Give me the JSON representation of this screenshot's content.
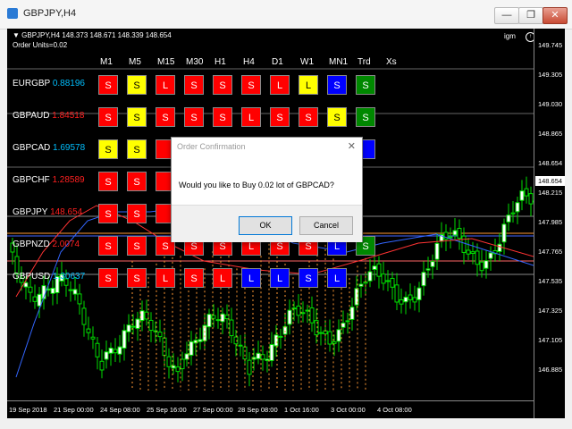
{
  "window": {
    "title": "GBPJPY,H4",
    "min": "—",
    "max": "❐",
    "close": "✕"
  },
  "chart": {
    "symbol_line": "▼ GBPJPY,H4  148.373 148.671 148.339 148.654",
    "order_units": "Order Units=0.02",
    "logo": "igm",
    "current_price": "148.654",
    "y_ticks": [
      "149.745",
      "149.305",
      "149.030",
      "148.865",
      "148.654",
      "148.215",
      "147.985",
      "147.765",
      "147.535",
      "147.325",
      "147.105",
      "146.885"
    ],
    "x_ticks": [
      "19 Sep 2018",
      "21 Sep 00:00",
      "24 Sep 08:00",
      "25 Sep 16:00",
      "27 Sep 00:00",
      "28 Sep 08:00",
      "1 Oct 16:00",
      "3 Oct 00:00",
      "4 Oct 08:00"
    ]
  },
  "columns": [
    "M1",
    "M5",
    "M15",
    "M30",
    "H1",
    "H4",
    "D1",
    "W1",
    "MN1",
    "Trd",
    "Xs"
  ],
  "rows": [
    {
      "pair": "EURGBP",
      "value": "0.88196",
      "value_color": "blue",
      "cells": [
        [
          "S",
          "red"
        ],
        [
          "S",
          "yellow"
        ],
        [
          "L",
          "red"
        ],
        [
          "S",
          "red"
        ],
        [
          "S",
          "red"
        ],
        [
          "S",
          "red"
        ],
        [
          "L",
          "red"
        ],
        [
          "L",
          "yellow"
        ],
        [
          "S",
          "blue"
        ],
        [
          "S",
          "green"
        ]
      ]
    },
    {
      "pair": "GBPAUD",
      "value": "1.84518",
      "value_color": "red",
      "cells": [
        [
          "S",
          "red"
        ],
        [
          "S",
          "yellow"
        ],
        [
          "S",
          "red"
        ],
        [
          "S",
          "red"
        ],
        [
          "S",
          "red"
        ],
        [
          "L",
          "red"
        ],
        [
          "S",
          "red"
        ],
        [
          "S",
          "red"
        ],
        [
          "S",
          "yellow"
        ],
        [
          "S",
          "green"
        ]
      ]
    },
    {
      "pair": "GBPCAD",
      "value": "1.69578",
      "value_color": "blue",
      "cells": [
        [
          "S",
          "yellow"
        ],
        [
          "S",
          "yellow"
        ],
        [
          "",
          "red"
        ],
        [
          "",
          "red"
        ],
        [
          "",
          "red"
        ],
        [
          "",
          "red"
        ],
        [
          "",
          "red"
        ],
        [
          "",
          "red"
        ],
        [
          "",
          "green"
        ],
        [
          "",
          "blank"
        ]
      ]
    },
    {
      "pair": "GBPCHF",
      "value": "1.28589",
      "value_color": "red",
      "cells": [
        [
          "S",
          "red"
        ],
        [
          "S",
          "red"
        ],
        [
          "",
          "red"
        ],
        [
          "",
          "red"
        ],
        [
          "",
          "red"
        ],
        [
          "",
          "red"
        ],
        [
          "",
          "red"
        ],
        [
          "",
          "red"
        ],
        [
          "",
          "green"
        ],
        [
          "",
          "none"
        ]
      ]
    },
    {
      "pair": "GBPJPY",
      "value": "148.654",
      "value_color": "red",
      "cells": [
        [
          "S",
          "red"
        ],
        [
          "S",
          "red"
        ],
        [
          "",
          "red"
        ],
        [
          "",
          "red"
        ],
        [
          "",
          "red"
        ],
        [
          "",
          "red"
        ],
        [
          "",
          "red"
        ],
        [
          "",
          "red"
        ],
        [
          "",
          "green"
        ],
        [
          "",
          "none"
        ]
      ]
    },
    {
      "pair": "GBPNZD",
      "value": "2.0074",
      "value_color": "red",
      "cells": [
        [
          "S",
          "red"
        ],
        [
          "S",
          "red"
        ],
        [
          "S",
          "red"
        ],
        [
          "S",
          "red"
        ],
        [
          "S",
          "red"
        ],
        [
          "L",
          "red"
        ],
        [
          "S",
          "red"
        ],
        [
          "S",
          "red"
        ],
        [
          "L",
          "blue"
        ],
        [
          "S",
          "green"
        ]
      ]
    },
    {
      "pair": "GBPUSD",
      "value": "1.30637",
      "value_color": "blue",
      "cells": [
        [
          "S",
          "red"
        ],
        [
          "S",
          "red"
        ],
        [
          "L",
          "red"
        ],
        [
          "S",
          "red"
        ],
        [
          "L",
          "red"
        ],
        [
          "L",
          "blue"
        ],
        [
          "L",
          "blue"
        ],
        [
          "S",
          "blue"
        ],
        [
          "L",
          "blue"
        ],
        [
          "",
          "none"
        ]
      ]
    }
  ],
  "dialog": {
    "title": "Order Confirmation",
    "message": "Would you like to Buy 0.02 lot of GBPCAD?",
    "ok": "OK",
    "cancel": "Cancel"
  }
}
